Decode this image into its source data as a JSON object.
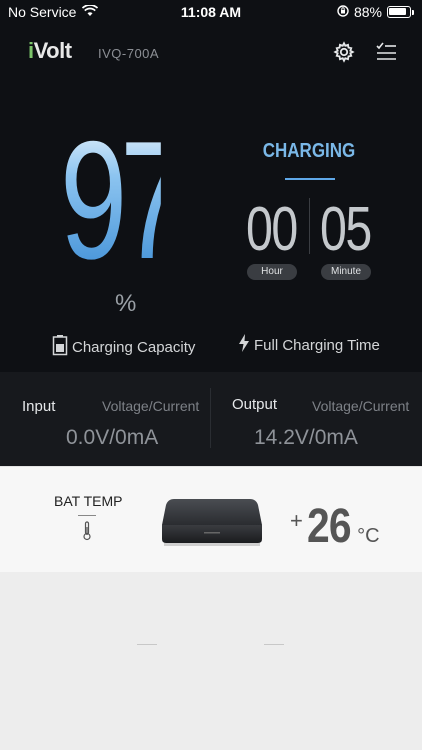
{
  "status_bar": {
    "carrier": "No Service",
    "time": "11:08 AM",
    "battery_percent": "88%",
    "battery_level": 0.88
  },
  "header": {
    "brand_prefix": "i",
    "brand_name": "Volt",
    "model": "IVQ-700A"
  },
  "capacity": {
    "value": "97",
    "unit": "%",
    "label": "Charging Capacity"
  },
  "charging": {
    "status": "CHARGING",
    "hours": "00",
    "minutes": "05",
    "hour_label": "Hour",
    "minute_label": "Minute",
    "label": "Full Charging Time"
  },
  "input": {
    "title": "Input",
    "subtitle": "Voltage/Current",
    "value": "0.0V/0mA"
  },
  "output": {
    "title": "Output",
    "subtitle": "Voltage/Current",
    "value": "14.2V/0mA"
  },
  "temperature": {
    "label": "BAT TEMP",
    "sign": "+",
    "value": "26",
    "unit": "°C"
  },
  "colors": {
    "accent_blue": "#5fa8e8",
    "brand_green": "#7cc46a",
    "dark_bg": "#0e1014"
  },
  "icons": [
    "wifi-icon",
    "orientation-lock-icon",
    "battery-icon",
    "settings-gear-icon",
    "checklist-icon",
    "battery-small-icon",
    "lightning-icon",
    "thermometer-icon"
  ]
}
